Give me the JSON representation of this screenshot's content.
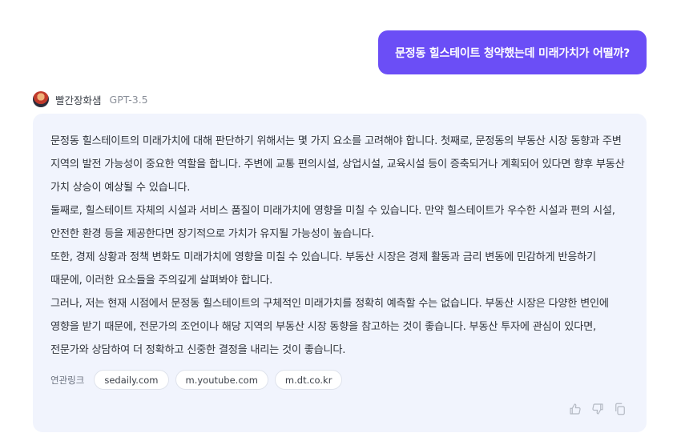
{
  "user_message": "문정동 힐스테이트 청약했는데 미래가치가 어떨까?",
  "bot": {
    "name": "빨간장화샘",
    "model": "GPT-3.5",
    "avatar_icon": "user-avatar"
  },
  "answer": {
    "paragraphs": [
      "문정동 힐스테이트의 미래가치에 대해 판단하기 위해서는 몇 가지 요소를 고려해야 합니다. 첫째로, 문정동의 부동산 시장 동향과 주변 지역의 발전 가능성이 중요한 역할을 합니다. 주변에 교통 편의시설, 상업시설, 교육시설 등이 증축되거나 계획되어 있다면 향후 부동산 가치 상승이 예상될 수 있습니다.",
      "둘째로, 힐스테이트 자체의 시설과 서비스 품질이 미래가치에 영향을 미칠 수 있습니다. 만약 힐스테이트가 우수한 시설과 편의 시설, 안전한 환경 등을 제공한다면 장기적으로 가치가 유지될 가능성이 높습니다.",
      "또한, 경제 상황과 정책 변화도 미래가치에 영향을 미칠 수 있습니다. 부동산 시장은 경제 활동과 금리 변동에 민감하게 반응하기 때문에, 이러한 요소들을 주의깊게 살펴봐야 합니다.",
      "그러나, 저는 현재 시점에서 문정동 힐스테이트의 구체적인 미래가치를 정확히 예측할 수는 없습니다. 부동산 시장은 다양한 변인에 영향을 받기 때문에, 전문가의 조언이나 해당 지역의 부동산 시장 동향을 참고하는 것이 좋습니다. 부동산 투자에 관심이 있다면, 전문가와 상담하여 더 정확하고 신중한 결정을 내리는 것이 좋습니다."
    ]
  },
  "related_links": {
    "label": "연관링크",
    "items": [
      "sedaily.com",
      "m.youtube.com",
      "m.dt.co.kr"
    ]
  },
  "actions": {
    "icons": [
      "thumbs-up-icon",
      "thumbs-down-icon",
      "copy-icon"
    ]
  },
  "colors": {
    "accent": "#6b4ef6",
    "card_background": "#f1f4fd"
  }
}
